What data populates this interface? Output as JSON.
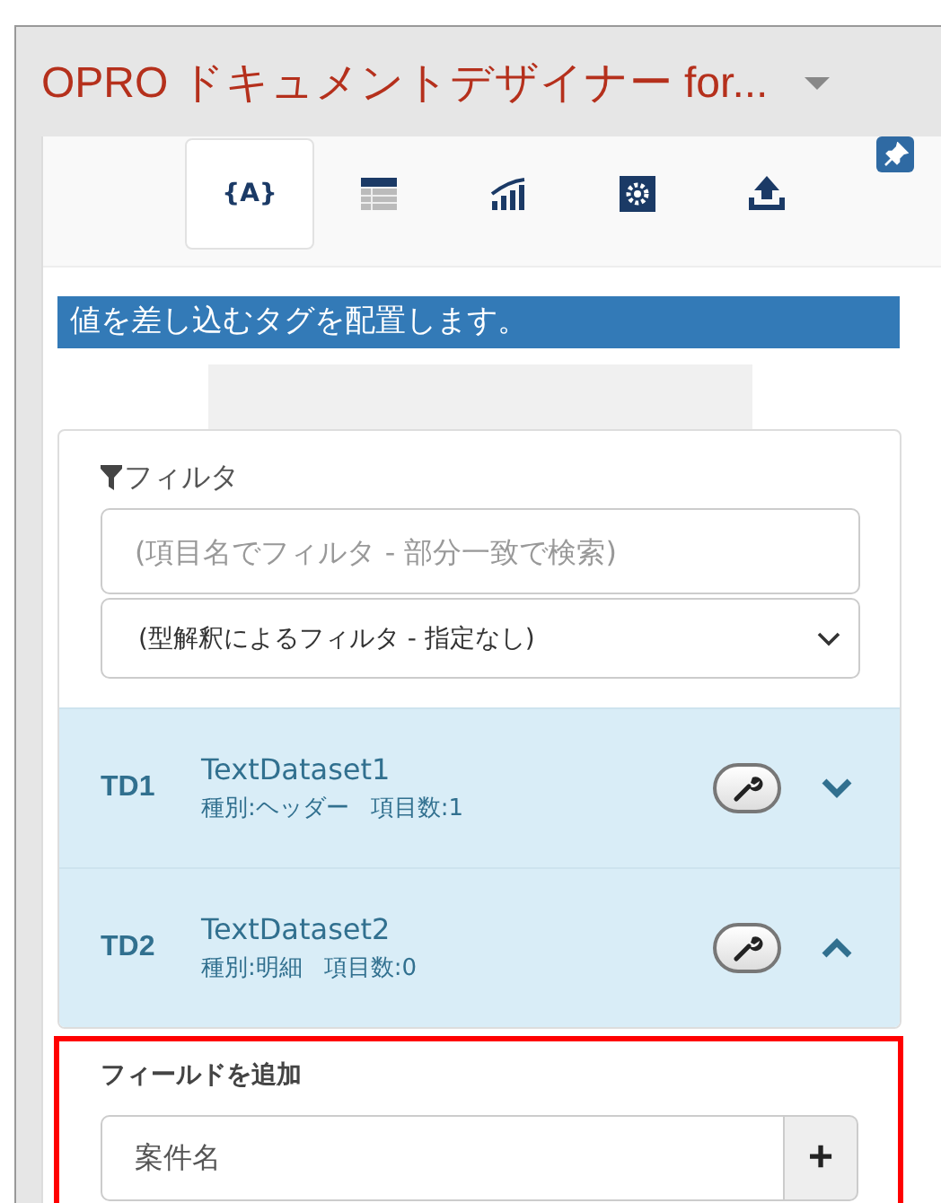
{
  "panel": {
    "title": "OPRO ドキュメントデザイナー for..."
  },
  "toolbar": {
    "tabs": [
      {
        "kind": "tag",
        "glyph": "{A}",
        "selected": true
      },
      {
        "kind": "table",
        "selected": false
      },
      {
        "kind": "chart",
        "selected": false
      },
      {
        "kind": "settings",
        "selected": false
      },
      {
        "kind": "upload",
        "selected": false
      }
    ],
    "pinned": true
  },
  "info": "値を差し込むタグを配置します。",
  "filter": {
    "label": "フィルタ",
    "placeholder": "(項目名でフィルタ - 部分一致で検索)",
    "type_filter": "(型解釈によるフィルタ - 指定なし)"
  },
  "datasets": [
    {
      "code": "TD1",
      "name": "TextDataset1",
      "meta": [
        "種別:ヘッダー",
        "項目数:1"
      ],
      "expanded": false
    },
    {
      "code": "TD2",
      "name": "TextDataset2",
      "meta": [
        "種別:明細",
        "項目数:0"
      ],
      "expanded": true
    }
  ],
  "add_field": {
    "label": "フィールドを追加",
    "value": "案件名",
    "button": "+"
  }
}
